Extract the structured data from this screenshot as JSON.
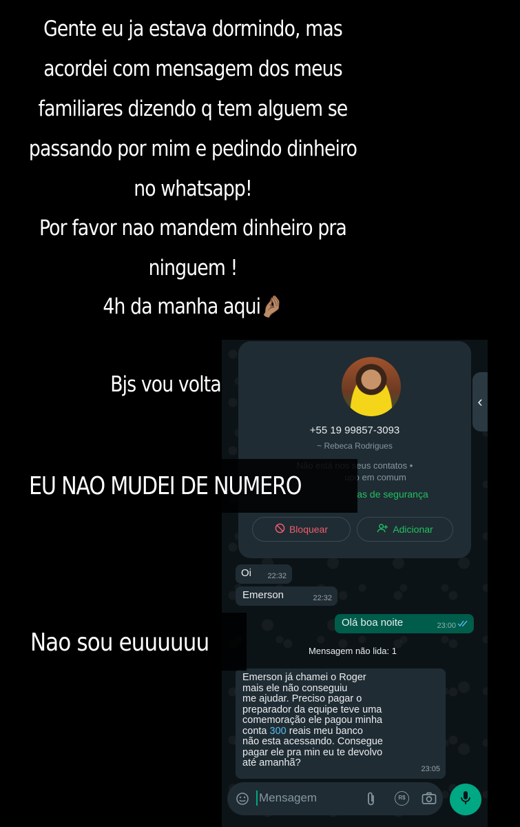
{
  "story": {
    "lines": [
      "Gente eu ja estava dormindo, mas",
      "acordei com mensagem dos meus",
      "familiares dizendo q tem alguem se",
      "passando por mim e pedindo dinheiro",
      "no whatsapp!",
      "Por favor nao mandem dinheiro pra",
      "ninguem !",
      "4h da manha aqui"
    ],
    "emoji": "🤌🏽",
    "bjs": "Bjs vou voltar",
    "numero": "EU NAO MUDEI DE NUMERO",
    "nao_sou": "Nao sou euuuuuu"
  },
  "whatsapp": {
    "contact": {
      "phone": "+55 19 99857-3093",
      "name": "~ Rebeca Rodrigues",
      "not_in_contacts_1": "Não está nos seus contatos •",
      "not_in_contacts_2": "upo em comum",
      "safety_link": "as de segurança"
    },
    "block_label": "Bloquear",
    "add_label": "Adicionar",
    "messages": [
      {
        "text": "Oi",
        "time": "22:32"
      },
      {
        "text": "Emerson",
        "time": "22:32"
      },
      {
        "text": "Olá boa noite",
        "time": "23:00"
      }
    ],
    "unread_label": "Mensagem não lida: 1",
    "long_message": {
      "lines": [
        "Emerson já chamei o Roger",
        "mais ele não conseguiu",
        "me ajudar.  Preciso pagar o",
        "preparador da equipe teve uma",
        "comemoração ele pagou minha",
        "conta",
        "reais meu banco",
        "não esta acessando.  Consegue",
        "pagar ele pra min eu te devolvo",
        "até amanhã?"
      ],
      "amount": "300",
      "time": "23:05"
    },
    "input_placeholder": "Mensagem",
    "currency_icon_label": "R$",
    "colors": {
      "accent_green": "#21c063",
      "outgoing_bubble": "#005c4b",
      "incoming_bubble": "#202c33",
      "block_red": "#f15c6d",
      "link_blue": "#53bdeb"
    }
  }
}
